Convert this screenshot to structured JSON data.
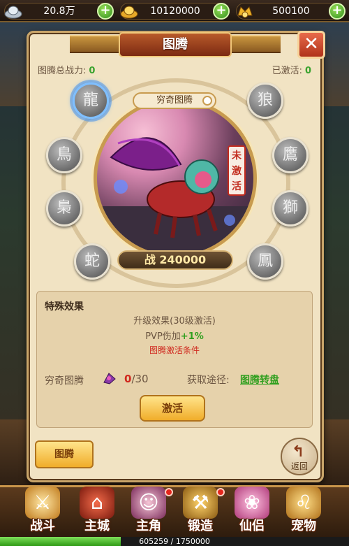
{
  "resources": {
    "silver": {
      "value": "20.8万",
      "icon": "silver-ingot-icon"
    },
    "gold": {
      "value": "10120000",
      "icon": "gold-ingot-icon"
    },
    "gem": {
      "value": "500100",
      "icon": "treasure-icon"
    }
  },
  "panel": {
    "title": "图腾",
    "total_power_label": "图腾总战力:",
    "total_power_value": "0",
    "activated_label": "已激活:",
    "activated_value": "0"
  },
  "totem": {
    "name": "穷奇图腾",
    "status_seal": "未激活",
    "power_text": "战 240000"
  },
  "effect": {
    "title": "特殊效果",
    "line1": "升级效果(30级激活)",
    "pvp_label": "PVP伤加",
    "pvp_value": "+1%",
    "condition": "图腾激活条件"
  },
  "material": {
    "label": "穷奇图腾",
    "current": "0",
    "total": "/30",
    "get_label": "获取途径:",
    "get_link": "图腾转盘"
  },
  "buttons": {
    "activate": "激活",
    "tab_totem": "图腾",
    "back": "返回",
    "close": "✕"
  },
  "nav": [
    {
      "label": "战斗",
      "icon": "sword-icon"
    },
    {
      "label": "主城",
      "icon": "castle-icon"
    },
    {
      "label": "主角",
      "icon": "hero-icon"
    },
    {
      "label": "锻造",
      "icon": "hammer-icon"
    },
    {
      "label": "仙侣",
      "icon": "fairy-icon"
    },
    {
      "label": "宠物",
      "icon": "lion-pet-icon"
    }
  ],
  "exp": {
    "text": "605259 / 1750000",
    "fraction": 0.346
  },
  "colors": {
    "accent_green": "#2f9f1e",
    "accent_red": "#d0281e",
    "panel_bg": "#f1e3c3"
  }
}
